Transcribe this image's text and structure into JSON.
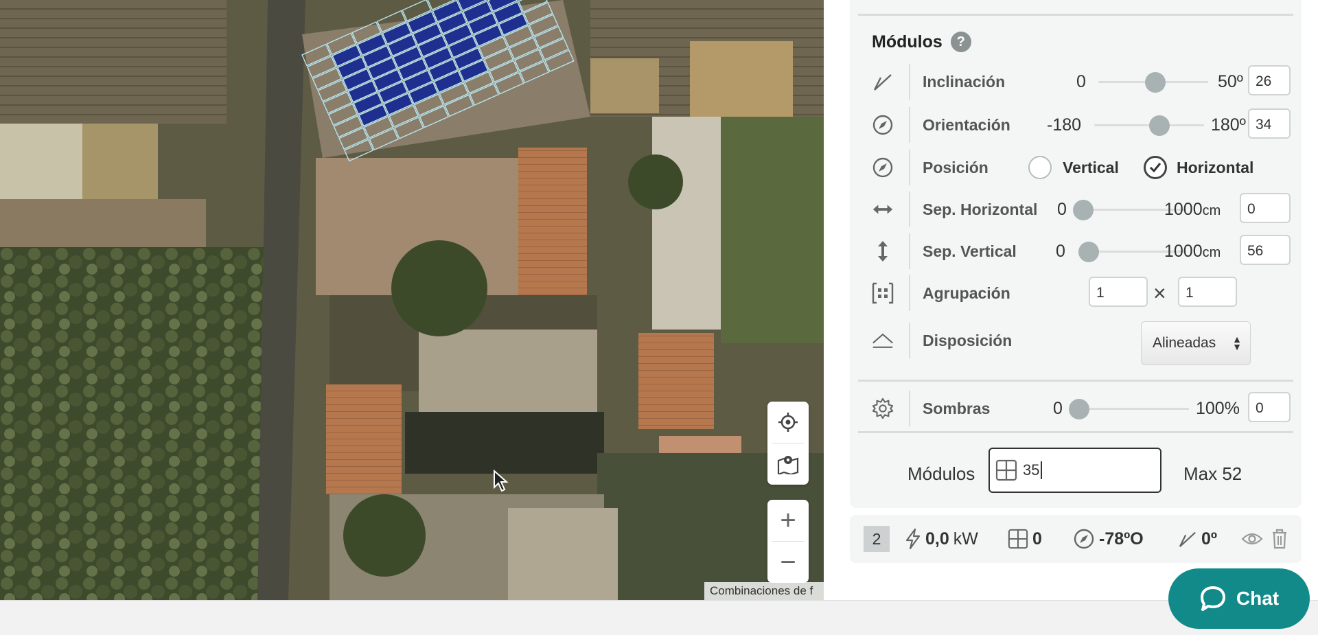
{
  "map": {
    "attribution": "Combinaciones de f",
    "zoom_in": "+",
    "zoom_out": "−"
  },
  "modules_panel": {
    "title": "Módulos",
    "help": "?",
    "inclinacion": {
      "label": "Inclinación",
      "min": "0",
      "max": "50º",
      "value": "26",
      "level": 0.52
    },
    "orientacion": {
      "label": "Orientación",
      "min": "-180",
      "max": "180º",
      "value": "34",
      "level": 0.594
    },
    "posicion": {
      "label": "Posición",
      "option_vertical": "Vertical",
      "option_horizontal": "Horizontal",
      "selected": "Horizontal"
    },
    "sep_horizontal": {
      "label": "Sep. Horizontal",
      "min": "0",
      "max": "1000",
      "unit": "cm",
      "value": "0",
      "level": 0.0
    },
    "sep_vertical": {
      "label": "Sep. Vertical",
      "min": "0",
      "max": "1000",
      "unit": "cm",
      "value": "56",
      "level": 0.056
    },
    "agrupacion": {
      "label": "Agrupación",
      "value_a": "1",
      "times": "×",
      "value_b": "1"
    },
    "disposicion": {
      "label": "Disposición",
      "value": "Alineadas"
    },
    "sombras": {
      "label": "Sombras",
      "min": "0",
      "max": "100%",
      "value": "0",
      "level": 0.0
    },
    "modulos_count": {
      "label": "Módulos",
      "value": "35",
      "max_label": "Max 52"
    }
  },
  "summary": {
    "index": "2",
    "power": "0,0",
    "power_unit": "kW",
    "modules": "0",
    "orientation": "-78ºO",
    "tilt": "0º"
  },
  "chat": {
    "label": "Chat"
  },
  "colors": {
    "accent": "#138a8a",
    "panel_bg": "#f4f5f5",
    "solar_panel": "#1f2f8f"
  }
}
